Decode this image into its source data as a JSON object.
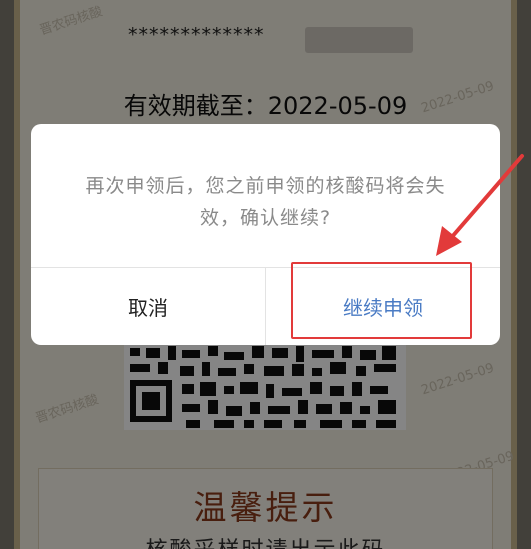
{
  "background": {
    "masked_id": "*************",
    "validity_label": "有效期截至：",
    "validity_date": "2022-05-09",
    "watermarks": [
      "晋农码核酸",
      "2022-05-09",
      "晋农码核酸",
      "2022-05-09",
      "2022-05-09"
    ],
    "tips": {
      "title": "温馨提示",
      "subtitle": "核酸采样时请出示此码"
    }
  },
  "dialog": {
    "message": "再次申领后，您之前申领的核酸码将会失效，确认继续?",
    "cancel_label": "取消",
    "continue_label": "继续申领"
  },
  "colors": {
    "continue_button": "#4a7bc4",
    "annotation_red": "#e23a3a",
    "card_background": "#f4efe2",
    "tips_title": "#8a3a1c"
  },
  "icons": [
    "annotation-arrow-icon",
    "qr-code-icon"
  ]
}
